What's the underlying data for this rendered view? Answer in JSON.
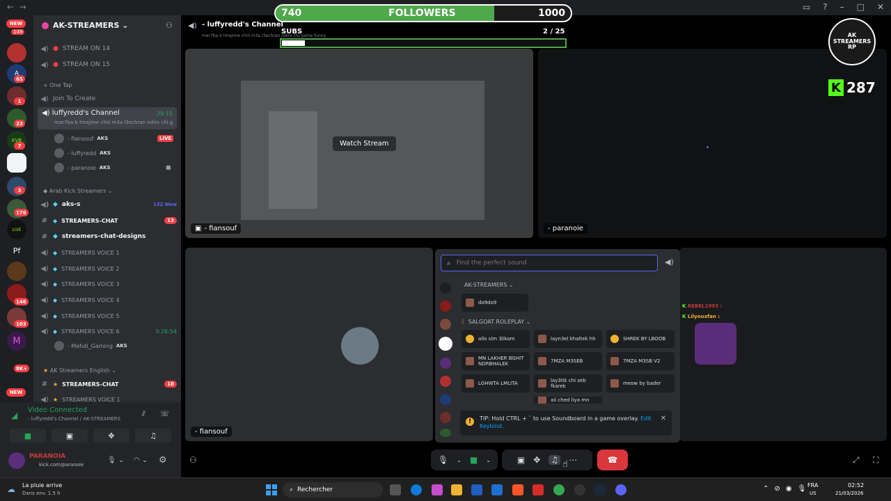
{
  "overlay": {
    "followers_current": "740",
    "followers_label": "FOLLOWERS",
    "followers_goal": "1000",
    "followers_progress": 0.74,
    "subs_label": "SUBS",
    "subs_current": "2",
    "subs_sep": "/",
    "subs_goal": "25",
    "subs_progress": 0.08,
    "kick_count": "287",
    "logo_text": "AK STREAMERS RP"
  },
  "rail": {
    "new_top": "NEW",
    "new_top_count": "149",
    "badges": [
      "",
      "65",
      "1",
      "23",
      "7",
      "",
      "3",
      "176",
      "",
      "",
      "146",
      "103",
      "",
      "8K+"
    ],
    "new_bottom": "NEW",
    "pf": "Pf"
  },
  "server": {
    "name": "AK-STREAMERS",
    "channels": [
      {
        "label": "STREAM ON 14",
        "type": "voice"
      },
      {
        "label": "STREAM ON 15",
        "type": "voice"
      }
    ],
    "onetap_category": "One Tap",
    "join_to_create": "Join To Create",
    "current_channel": "luffyredd's Channel",
    "current_time": "29:15",
    "current_status": "mar7ba b lmajime chiil m3a l3echran ndiro chi g...",
    "members": [
      {
        "name": "- fiansouf",
        "tag": "AKS",
        "live": "LIVE"
      },
      {
        "name": "- luffyredd",
        "tag": "AKS"
      },
      {
        "name": "- paranoie",
        "tag": "AKS"
      }
    ],
    "arab_category": "Arab Kick Streamers",
    "aks_s": "aks-s",
    "aks_s_new": "132 New",
    "streamers_chat": "STREAMERS-CHAT",
    "streamers_chat_count": "13",
    "streamers_chat_designs": "streamers-chat-designs",
    "voices": [
      "STREAMERS VOICE 1",
      "STREAMERS VOICE 2",
      "STREAMERS VOICE 3",
      "STREAMERS VOICE 4",
      "STREAMERS VOICE 5",
      "STREAMERS VOICE 6"
    ],
    "voice6_time": "3:26:54",
    "voice6_member": "- Mehdi_Gaming",
    "voice6_tag": "AKS",
    "english_category": "AK Streamers English",
    "english_chat": "STREAMERS-CHAT",
    "english_chat_count": "18",
    "english_voice": "STREAMERS VOICE 1"
  },
  "voice_panel": {
    "status": "Video Connected",
    "location": "- luffyredd's Channel / AK-STREAMERS",
    "username": "PARANOIA",
    "user_sub": "kick.com/paranoie"
  },
  "call": {
    "title": "- luffyredd's Channel",
    "subtitle": "mar7ba b lmajime chiil m3a l3echran ndiro chi game funny",
    "watch_stream": "Watch Stream",
    "tile1_label": "- fiansouf",
    "tile2_label": "- paranoie",
    "tile3_label": "- fiansouf"
  },
  "soundboard": {
    "search_placeholder": "Find the perfect sound",
    "group1": "AK-STREAMERS",
    "group1_sounds": [
      "do9do9"
    ],
    "group2": "SALGOAT ROLEPLAY",
    "group2_sounds": [
      "allo slm 3likom",
      "layn3el khaltek hh",
      "SHREK BY LBOOB",
      "MN LAKHER BGHIT NDRBHALEK",
      "7MZA M3SEB",
      "7MZA M3SB V2",
      "LGHWTA LMLITA",
      "lay3tik chi zeb fkarek",
      "meow by bader",
      "aii ched liya mn"
    ],
    "tip": "TIP: Hold CTRL + ` to use Soundboard in a game overlay.",
    "tip_link": "Edit Keybind."
  },
  "chat_overlay": {
    "line1_user": "REBEL1993",
    "line2_user": "Lilyouxfan"
  },
  "taskbar": {
    "weather_title": "La pluie arrive",
    "weather_sub": "Dans env. 1.5 h",
    "search": "Rechercher",
    "lang": "FRA",
    "lang_sub": "US",
    "time": "02:52",
    "date": "21/03/2026"
  },
  "colors": {
    "green": "#4ea94a",
    "red": "#f23f43",
    "blurple": "#5865f2",
    "hangup": "#da373c"
  }
}
